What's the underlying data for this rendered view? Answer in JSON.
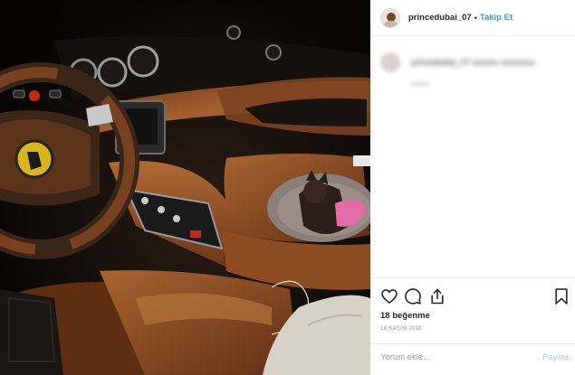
{
  "post": {
    "username": "princedubai_07",
    "separator": "•",
    "follow_label": "Takip Et",
    "caption": {
      "text": "princedubai_07 xxxxxx xxxxxxxx",
      "sub": "xxxxx"
    },
    "likes_text": "18 beğenme",
    "date_text": "18 KASIM 2018",
    "comment_placeholder": "Yorum ekle...",
    "share_label": "Paylaş"
  },
  "icons": {
    "like": "heart-icon",
    "comment": "comment-bubble-icon",
    "share": "share-icon",
    "save": "bookmark-icon"
  },
  "colors": {
    "link": "#3897f0",
    "disabled_link": "#b2dffc",
    "leather": "#8a4a24",
    "border": "#efefef",
    "muted_text": "#999999"
  }
}
